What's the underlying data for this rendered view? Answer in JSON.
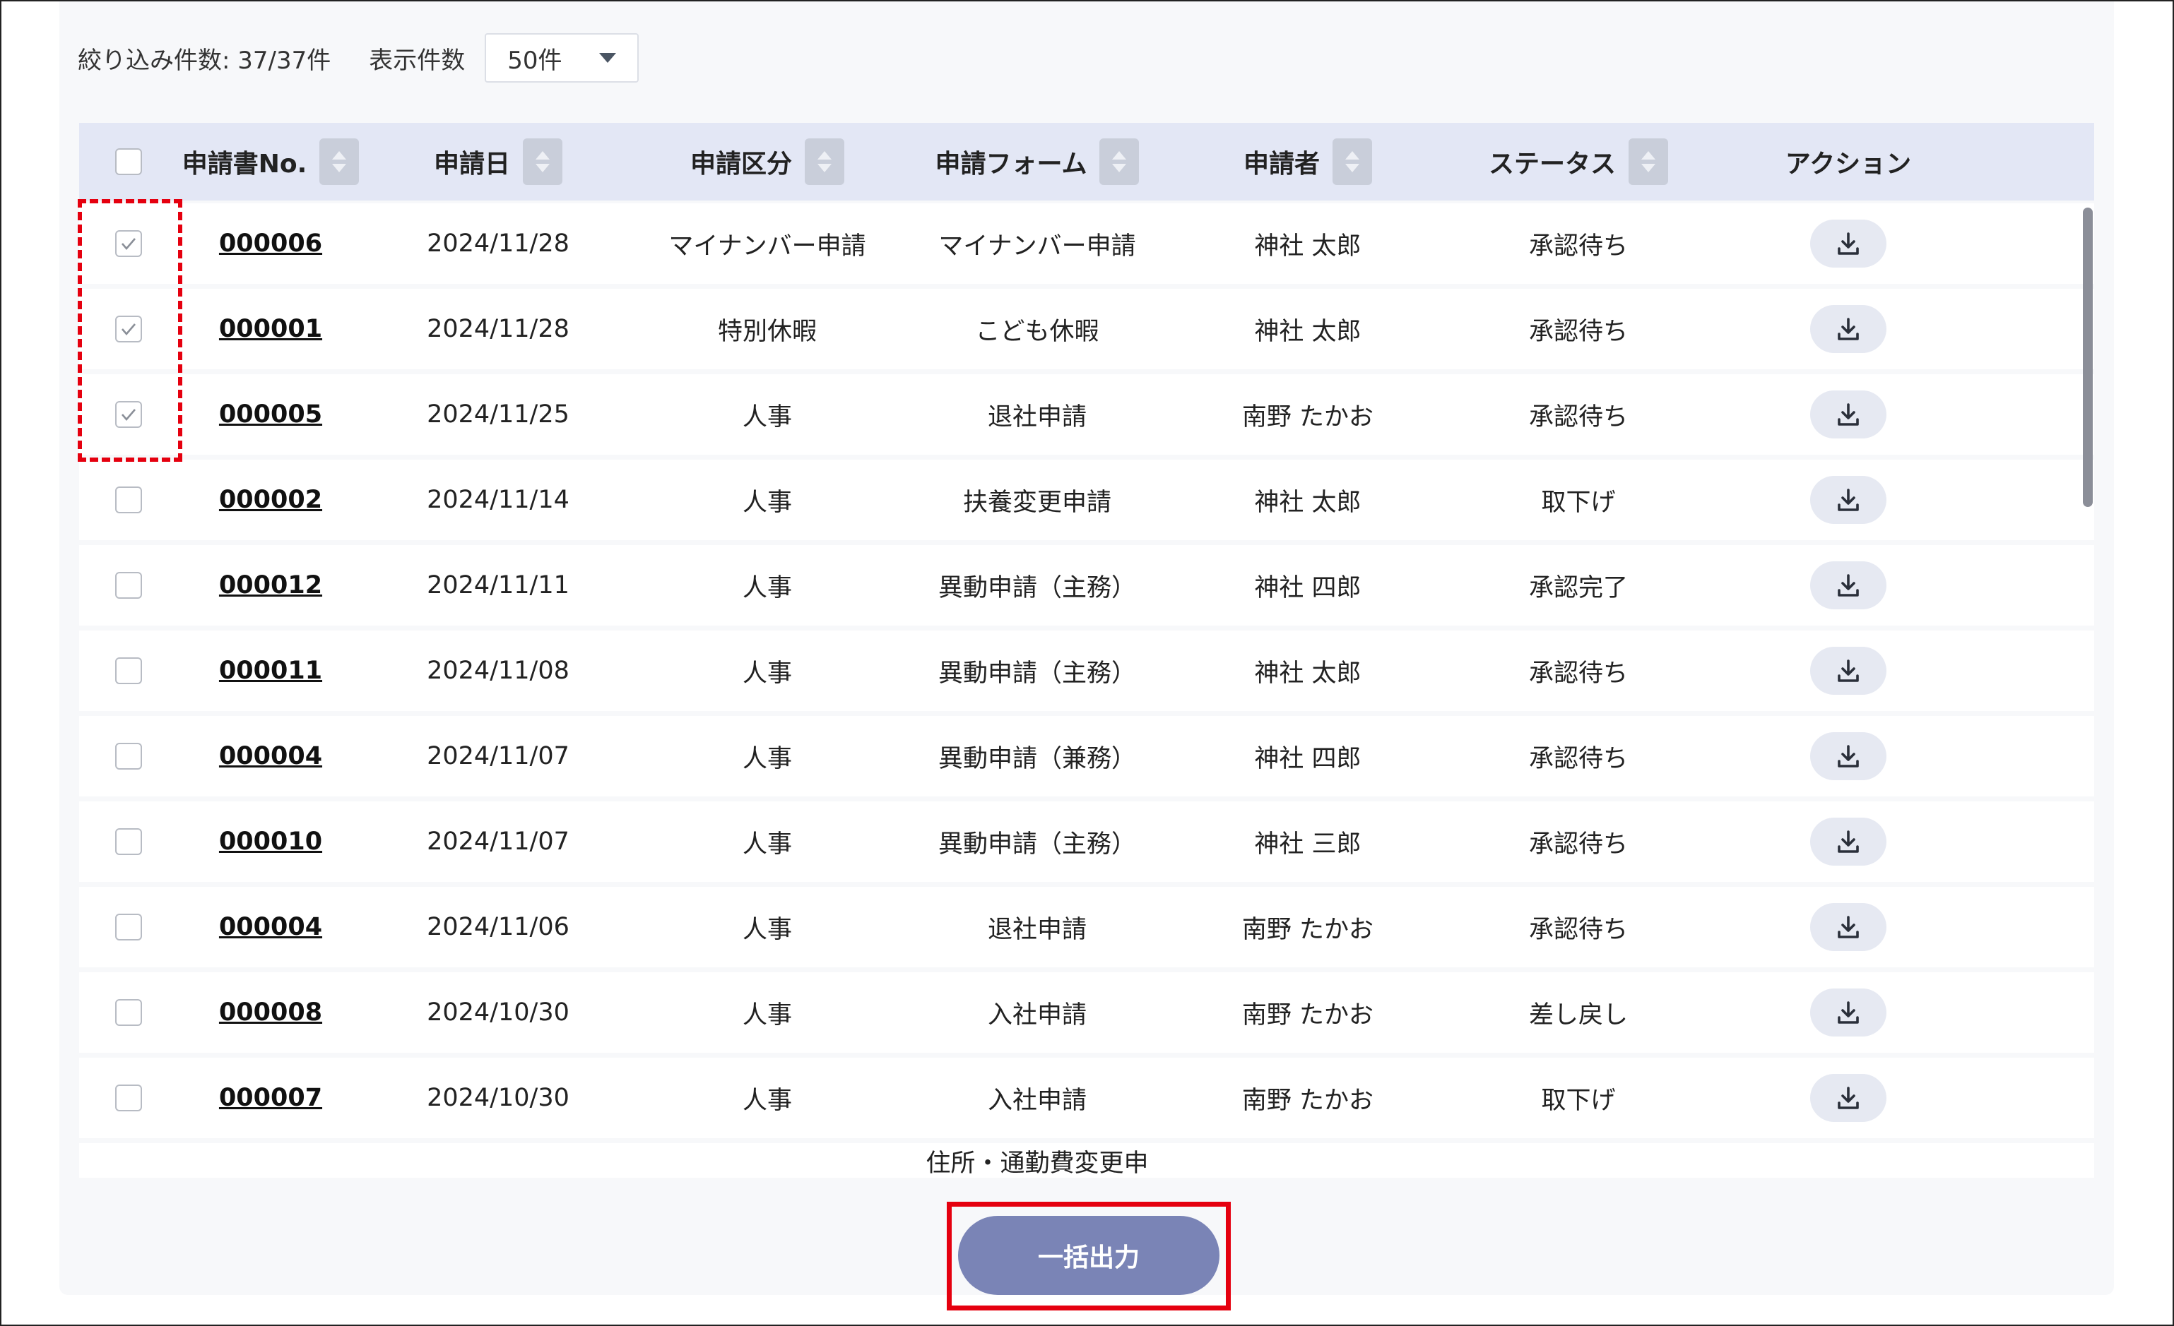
{
  "filter": {
    "count_label": "絞り込み件数: 37/37件",
    "display_label": "表示件数",
    "display_value": "50件"
  },
  "table": {
    "headers": [
      "申請書No.",
      "申請日",
      "申請区分",
      "申請フォーム",
      "申請者",
      "ステータス",
      "アクション"
    ],
    "rows": [
      {
        "checked": true,
        "no": "000006",
        "date": "2024/11/28",
        "category": "マイナンバー申請",
        "form": "マイナンバー申請",
        "applicant": "神社 太郎",
        "status": "承認待ち"
      },
      {
        "checked": true,
        "no": "000001",
        "date": "2024/11/28",
        "category": "特別休暇",
        "form": "こども休暇",
        "applicant": "神社 太郎",
        "status": "承認待ち"
      },
      {
        "checked": true,
        "no": "000005",
        "date": "2024/11/25",
        "category": "人事",
        "form": "退社申請",
        "applicant": "南野 たかお",
        "status": "承認待ち"
      },
      {
        "checked": false,
        "no": "000002",
        "date": "2024/11/14",
        "category": "人事",
        "form": "扶養変更申請",
        "applicant": "神社 太郎",
        "status": "取下げ"
      },
      {
        "checked": false,
        "no": "000012",
        "date": "2024/11/11",
        "category": "人事",
        "form": "異動申請（主務）",
        "applicant": "神社 四郎",
        "status": "承認完了"
      },
      {
        "checked": false,
        "no": "000011",
        "date": "2024/11/08",
        "category": "人事",
        "form": "異動申請（主務）",
        "applicant": "神社 太郎",
        "status": "承認待ち"
      },
      {
        "checked": false,
        "no": "000004",
        "date": "2024/11/07",
        "category": "人事",
        "form": "異動申請（兼務）",
        "applicant": "神社 四郎",
        "status": "承認待ち"
      },
      {
        "checked": false,
        "no": "000010",
        "date": "2024/11/07",
        "category": "人事",
        "form": "異動申請（主務）",
        "applicant": "神社 三郎",
        "status": "承認待ち"
      },
      {
        "checked": false,
        "no": "000004",
        "date": "2024/11/06",
        "category": "人事",
        "form": "退社申請",
        "applicant": "南野 たかお",
        "status": "承認待ち"
      },
      {
        "checked": false,
        "no": "000008",
        "date": "2024/10/30",
        "category": "人事",
        "form": "入社申請",
        "applicant": "南野 たかお",
        "status": "差し戻し"
      },
      {
        "checked": false,
        "no": "000007",
        "date": "2024/10/30",
        "category": "人事",
        "form": "入社申請",
        "applicant": "南野 たかお",
        "status": "取下げ"
      }
    ],
    "partial_row_form": "住所・通勤費変更申"
  },
  "bulk_button_label": "一括出力",
  "colors": {
    "header_bg": "#e3e7f5",
    "button_bg": "#7a84b6",
    "highlight_red": "#e5000f"
  }
}
